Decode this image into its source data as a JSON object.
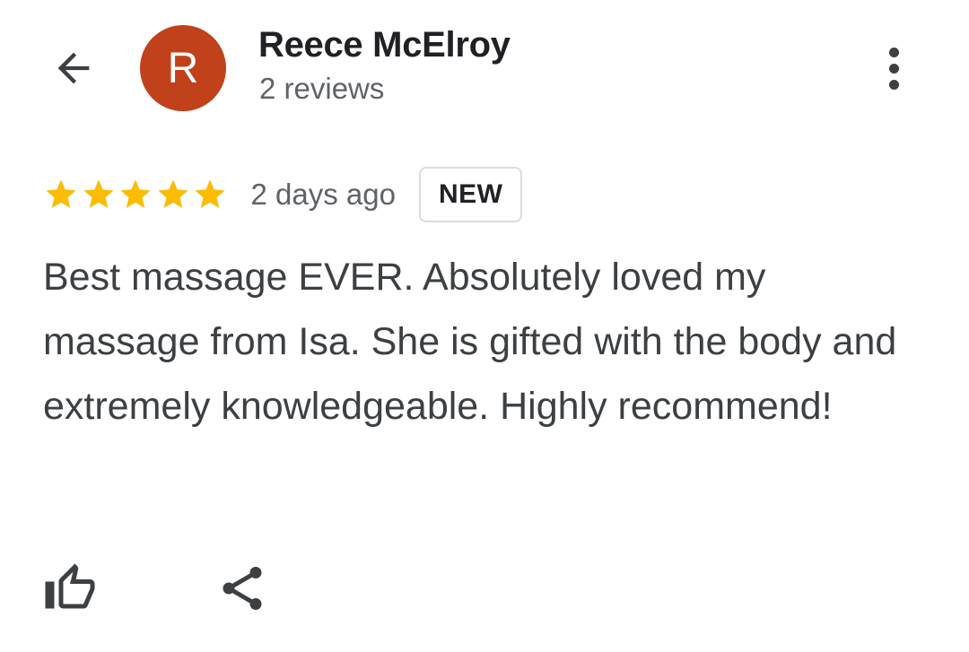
{
  "header": {
    "back_icon": "arrow-back-icon",
    "avatar_letter": "R",
    "avatar_color": "#c1421a",
    "reviewer_name": "Reece McElroy",
    "review_count": "2 reviews",
    "more_icon": "more-vert-icon"
  },
  "review": {
    "rating": 5,
    "rating_max": 5,
    "star_color": "#fbbc04",
    "date": "2 days ago",
    "badge": "NEW",
    "text": "Best massage EVER. Absolutely loved my massage from Isa. She is gifted with the body and extremely knowledgeable. Highly recommend!"
  },
  "actions": {
    "like_icon": "thumb-up-icon",
    "share_icon": "share-icon"
  }
}
